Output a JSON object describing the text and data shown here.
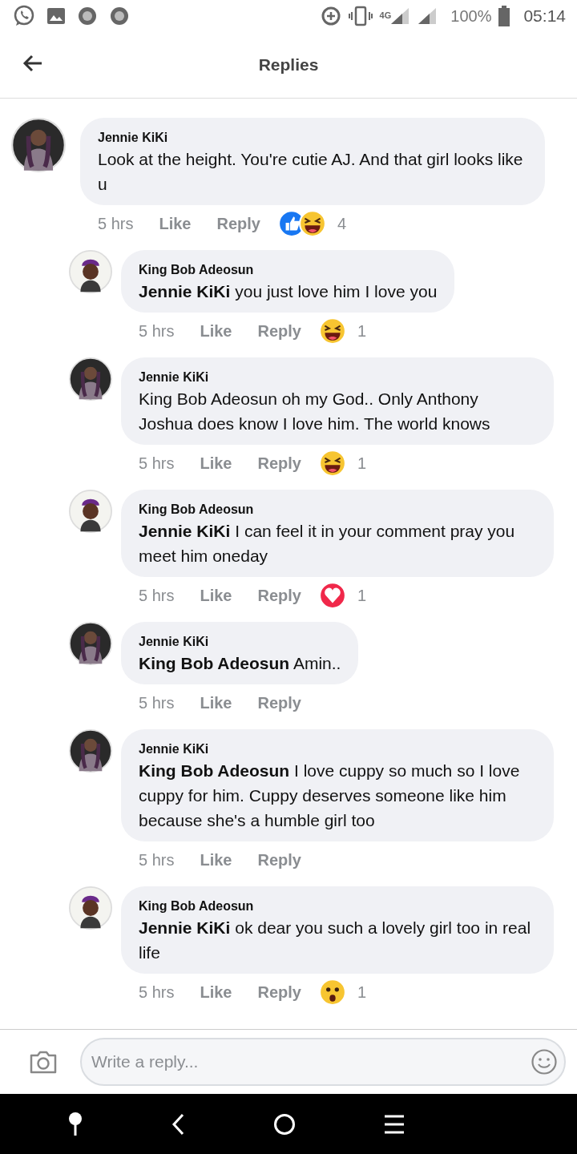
{
  "status_bar": {
    "network": "4G",
    "battery": "100%",
    "time": "05:14"
  },
  "header": {
    "title": "Replies"
  },
  "comments": [
    {
      "kind": "top",
      "avatar": {
        "kind": "woman"
      },
      "author": "Jennie KiKi",
      "text": "Look at the height. You're cutie AJ. And that girl looks like u",
      "time": "5 hrs",
      "like": "Like",
      "reply": "Reply",
      "reactions": [
        {
          "kind": "like"
        },
        {
          "kind": "haha"
        }
      ],
      "count": "4"
    },
    {
      "kind": "reply",
      "avatar": {
        "kind": "man"
      },
      "author": "King Bob Adeosun",
      "text": "**Jennie KiKi** you just love him I love you",
      "time": "5 hrs",
      "like": "Like",
      "reply": "Reply",
      "reactions": [
        {
          "kind": "haha"
        }
      ],
      "count": "1"
    },
    {
      "kind": "reply",
      "avatar": {
        "kind": "woman"
      },
      "author": "Jennie KiKi",
      "text": "King Bob Adeosun oh my God.. Only Anthony Joshua does know I love him. The world knows",
      "time": "5 hrs",
      "like": "Like",
      "reply": "Reply",
      "reactions": [
        {
          "kind": "haha"
        }
      ],
      "count": "1"
    },
    {
      "kind": "reply",
      "avatar": {
        "kind": "man"
      },
      "author": "King Bob Adeosun",
      "text": "**Jennie KiKi** I can feel it in your comment pray you meet him oneday",
      "time": "5 hrs",
      "like": "Like",
      "reply": "Reply",
      "reactions": [
        {
          "kind": "love"
        }
      ],
      "count": "1"
    },
    {
      "kind": "reply",
      "avatar": {
        "kind": "woman"
      },
      "author": "Jennie KiKi",
      "text": "**King Bob Adeosun** Amin..",
      "time": "5 hrs",
      "like": "Like",
      "reply": "Reply"
    },
    {
      "kind": "reply",
      "avatar": {
        "kind": "woman"
      },
      "author": "Jennie KiKi",
      "text": "**King Bob Adeosun** I love cuppy so much so I love cuppy for him. Cuppy deserves someone like him because she's a humble girl too",
      "time": "5 hrs",
      "like": "Like",
      "reply": "Reply"
    },
    {
      "kind": "reply",
      "avatar": {
        "kind": "man"
      },
      "author": "King Bob Adeosun",
      "text": "**Jennie KiKi** ok dear you such a lovely girl too in real life",
      "time": "5 hrs",
      "like": "Like",
      "reply": "Reply",
      "reactions": [
        {
          "kind": "wow"
        }
      ],
      "count": "1"
    }
  ],
  "composer": {
    "placeholder": "Write a reply..."
  }
}
